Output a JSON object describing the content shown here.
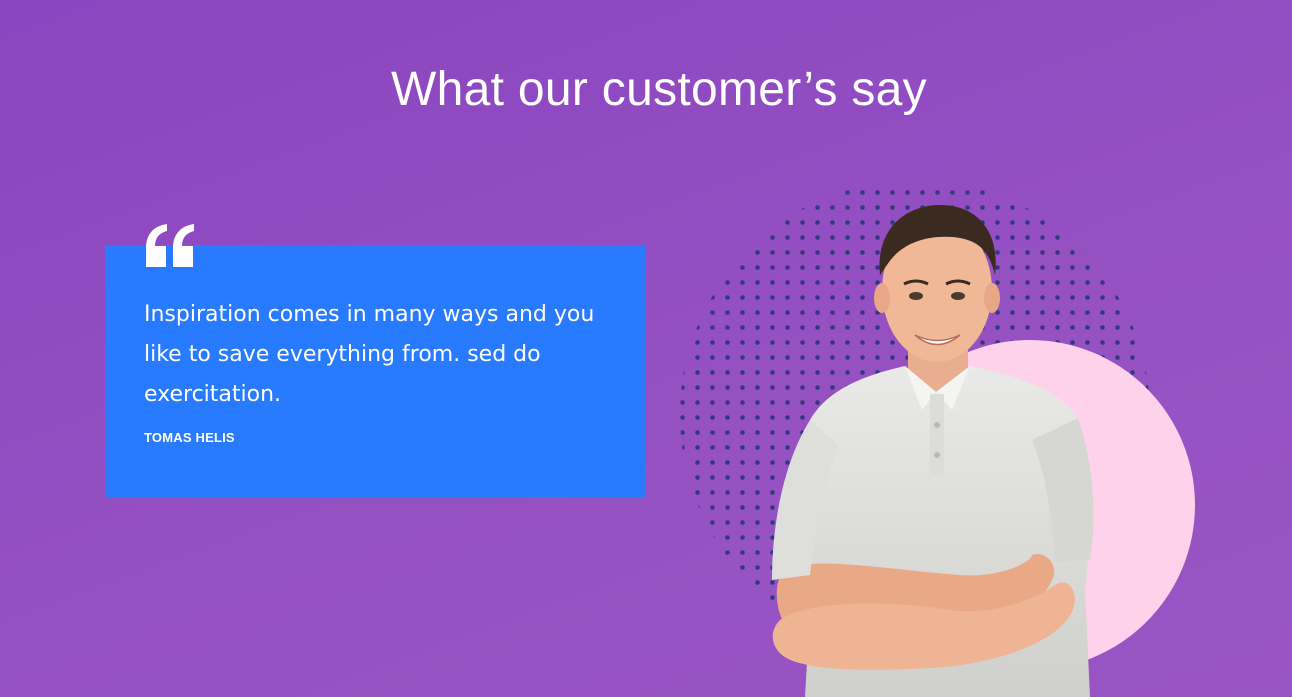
{
  "section": {
    "title": "What our customer’s say"
  },
  "testimonial": {
    "quote": "Inspiration comes in many ways and you like to save everything from. sed do exercitation.",
    "author": "TOMAS HELIS",
    "quote_icon": "quote-icon",
    "card_color": "#287bff"
  },
  "decor": {
    "background_color": "#9550c2",
    "circle_color": "#fdd2ea",
    "dots_color": "#2f3a7a"
  }
}
